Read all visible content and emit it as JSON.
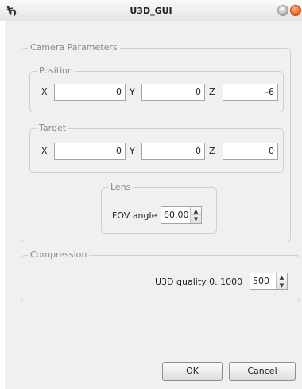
{
  "window": {
    "title": "U3D_GUI"
  },
  "camera": {
    "group_title": "Camera Parameters",
    "position": {
      "title": "Position",
      "x_label": "X",
      "x_value": "0",
      "y_label": "Y",
      "y_value": "0",
      "z_label": "Z",
      "z_value": "-6"
    },
    "target": {
      "title": "Target",
      "x_label": "X",
      "x_value": "0",
      "y_label": "Y",
      "y_value": "0",
      "z_label": "Z",
      "z_value": "0"
    },
    "lens": {
      "title": "Lens",
      "fov_label": "FOV angle",
      "fov_value": "60.00"
    }
  },
  "compression": {
    "group_title": "Compression",
    "quality_label": "U3D quality 0..1000",
    "quality_value": "500"
  },
  "buttons": {
    "ok": "OK",
    "cancel": "Cancel"
  },
  "icons": {
    "app": "app-icon",
    "minimize": "minimize-icon",
    "close": "close-icon",
    "spin_up": "spin-up-icon",
    "spin_down": "spin-down-icon"
  }
}
